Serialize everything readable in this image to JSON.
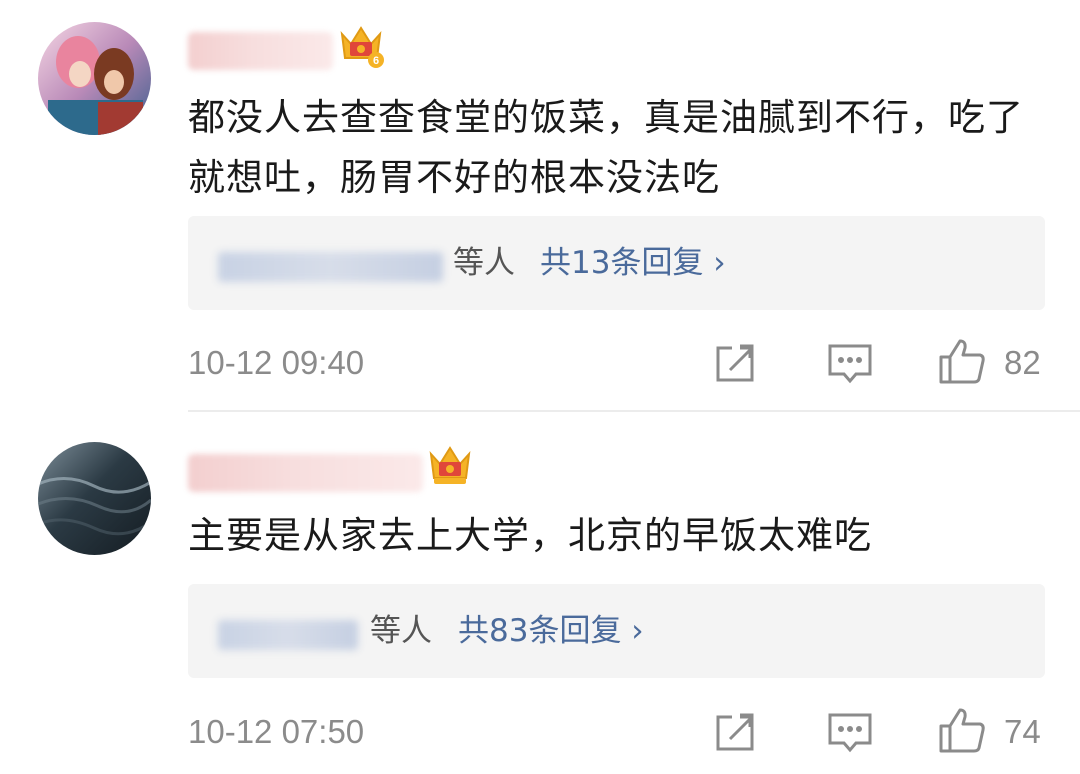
{
  "comments": [
    {
      "text": "都没人去查查食堂的饭菜，真是油腻到不行，吃了就想吐，肠胃不好的根本没法吃",
      "replies": {
        "suffix": "等人",
        "link": "共13条回复 ›"
      },
      "timestamp": "10-12 09:40",
      "like_count": "82",
      "vip_level": "6"
    },
    {
      "text": "主要是从家去上大学，北京的早饭太难吃",
      "replies": {
        "suffix": "等人",
        "link": "共83条回复 ›"
      },
      "timestamp": "10-12 07:50",
      "like_count": "74"
    }
  ],
  "icons": {
    "forward": "share-forward-icon",
    "comment": "comment-icon",
    "like": "thumbs-up-icon",
    "vip": "crown-icon"
  },
  "colors": {
    "text": "#1a1a1a",
    "meta": "#8b8b8b",
    "link": "#4a6a9b",
    "reply_bg": "#f4f4f4",
    "crown_gold": "#f5b326",
    "crown_red": "#e0463a"
  }
}
